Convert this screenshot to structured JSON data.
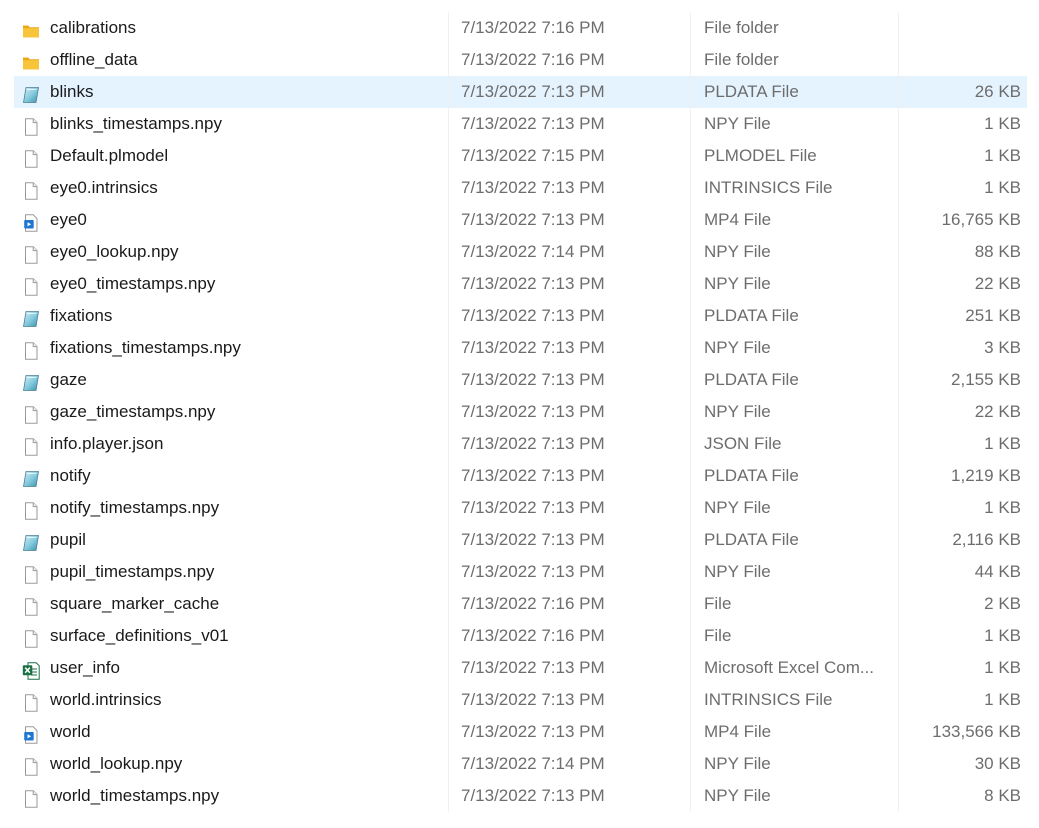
{
  "explorer": {
    "selected_index": 2,
    "files": [
      {
        "name": "calibrations",
        "date": "7/13/2022 7:16 PM",
        "type": "File folder",
        "size": "",
        "icon": "folder-icon"
      },
      {
        "name": "offline_data",
        "date": "7/13/2022 7:16 PM",
        "type": "File folder",
        "size": "",
        "icon": "folder-icon"
      },
      {
        "name": "blinks",
        "date": "7/13/2022 7:13 PM",
        "type": "PLDATA File",
        "size": "26 KB",
        "icon": "pldata-file-icon"
      },
      {
        "name": "blinks_timestamps.npy",
        "date": "7/13/2022 7:13 PM",
        "type": "NPY File",
        "size": "1 KB",
        "icon": "blank-file-icon"
      },
      {
        "name": "Default.plmodel",
        "date": "7/13/2022 7:15 PM",
        "type": "PLMODEL File",
        "size": "1 KB",
        "icon": "blank-file-icon"
      },
      {
        "name": "eye0.intrinsics",
        "date": "7/13/2022 7:13 PM",
        "type": "INTRINSICS File",
        "size": "1 KB",
        "icon": "blank-file-icon"
      },
      {
        "name": "eye0",
        "date": "7/13/2022 7:13 PM",
        "type": "MP4 File",
        "size": "16,765 KB",
        "icon": "video-file-icon"
      },
      {
        "name": "eye0_lookup.npy",
        "date": "7/13/2022 7:14 PM",
        "type": "NPY File",
        "size": "88 KB",
        "icon": "blank-file-icon"
      },
      {
        "name": "eye0_timestamps.npy",
        "date": "7/13/2022 7:13 PM",
        "type": "NPY File",
        "size": "22 KB",
        "icon": "blank-file-icon"
      },
      {
        "name": "fixations",
        "date": "7/13/2022 7:13 PM",
        "type": "PLDATA File",
        "size": "251 KB",
        "icon": "pldata-file-icon"
      },
      {
        "name": "fixations_timestamps.npy",
        "date": "7/13/2022 7:13 PM",
        "type": "NPY File",
        "size": "3 KB",
        "icon": "blank-file-icon"
      },
      {
        "name": "gaze",
        "date": "7/13/2022 7:13 PM",
        "type": "PLDATA File",
        "size": "2,155 KB",
        "icon": "pldata-file-icon"
      },
      {
        "name": "gaze_timestamps.npy",
        "date": "7/13/2022 7:13 PM",
        "type": "NPY File",
        "size": "22 KB",
        "icon": "blank-file-icon"
      },
      {
        "name": "info.player.json",
        "date": "7/13/2022 7:13 PM",
        "type": "JSON File",
        "size": "1 KB",
        "icon": "blank-file-icon"
      },
      {
        "name": "notify",
        "date": "7/13/2022 7:13 PM",
        "type": "PLDATA File",
        "size": "1,219 KB",
        "icon": "pldata-file-icon"
      },
      {
        "name": "notify_timestamps.npy",
        "date": "7/13/2022 7:13 PM",
        "type": "NPY File",
        "size": "1 KB",
        "icon": "blank-file-icon"
      },
      {
        "name": "pupil",
        "date": "7/13/2022 7:13 PM",
        "type": "PLDATA File",
        "size": "2,116 KB",
        "icon": "pldata-file-icon"
      },
      {
        "name": "pupil_timestamps.npy",
        "date": "7/13/2022 7:13 PM",
        "type": "NPY File",
        "size": "44 KB",
        "icon": "blank-file-icon"
      },
      {
        "name": "square_marker_cache",
        "date": "7/13/2022 7:16 PM",
        "type": "File",
        "size": "2 KB",
        "icon": "blank-file-icon"
      },
      {
        "name": "surface_definitions_v01",
        "date": "7/13/2022 7:16 PM",
        "type": "File",
        "size": "1 KB",
        "icon": "blank-file-icon"
      },
      {
        "name": "user_info",
        "date": "7/13/2022 7:13 PM",
        "type": "Microsoft Excel Com...",
        "size": "1 KB",
        "icon": "excel-file-icon"
      },
      {
        "name": "world.intrinsics",
        "date": "7/13/2022 7:13 PM",
        "type": "INTRINSICS File",
        "size": "1 KB",
        "icon": "blank-file-icon"
      },
      {
        "name": "world",
        "date": "7/13/2022 7:13 PM",
        "type": "MP4 File",
        "size": "133,566 KB",
        "icon": "video-file-icon"
      },
      {
        "name": "world_lookup.npy",
        "date": "7/13/2022 7:14 PM",
        "type": "NPY File",
        "size": "30 KB",
        "icon": "blank-file-icon"
      },
      {
        "name": "world_timestamps.npy",
        "date": "7/13/2022 7:13 PM",
        "type": "NPY File",
        "size": "8 KB",
        "icon": "blank-file-icon"
      }
    ]
  },
  "colors": {
    "selection": "#e5f3ff",
    "folder": "#f8c53a",
    "excel": "#1d7044",
    "video": "#1e78d2"
  }
}
